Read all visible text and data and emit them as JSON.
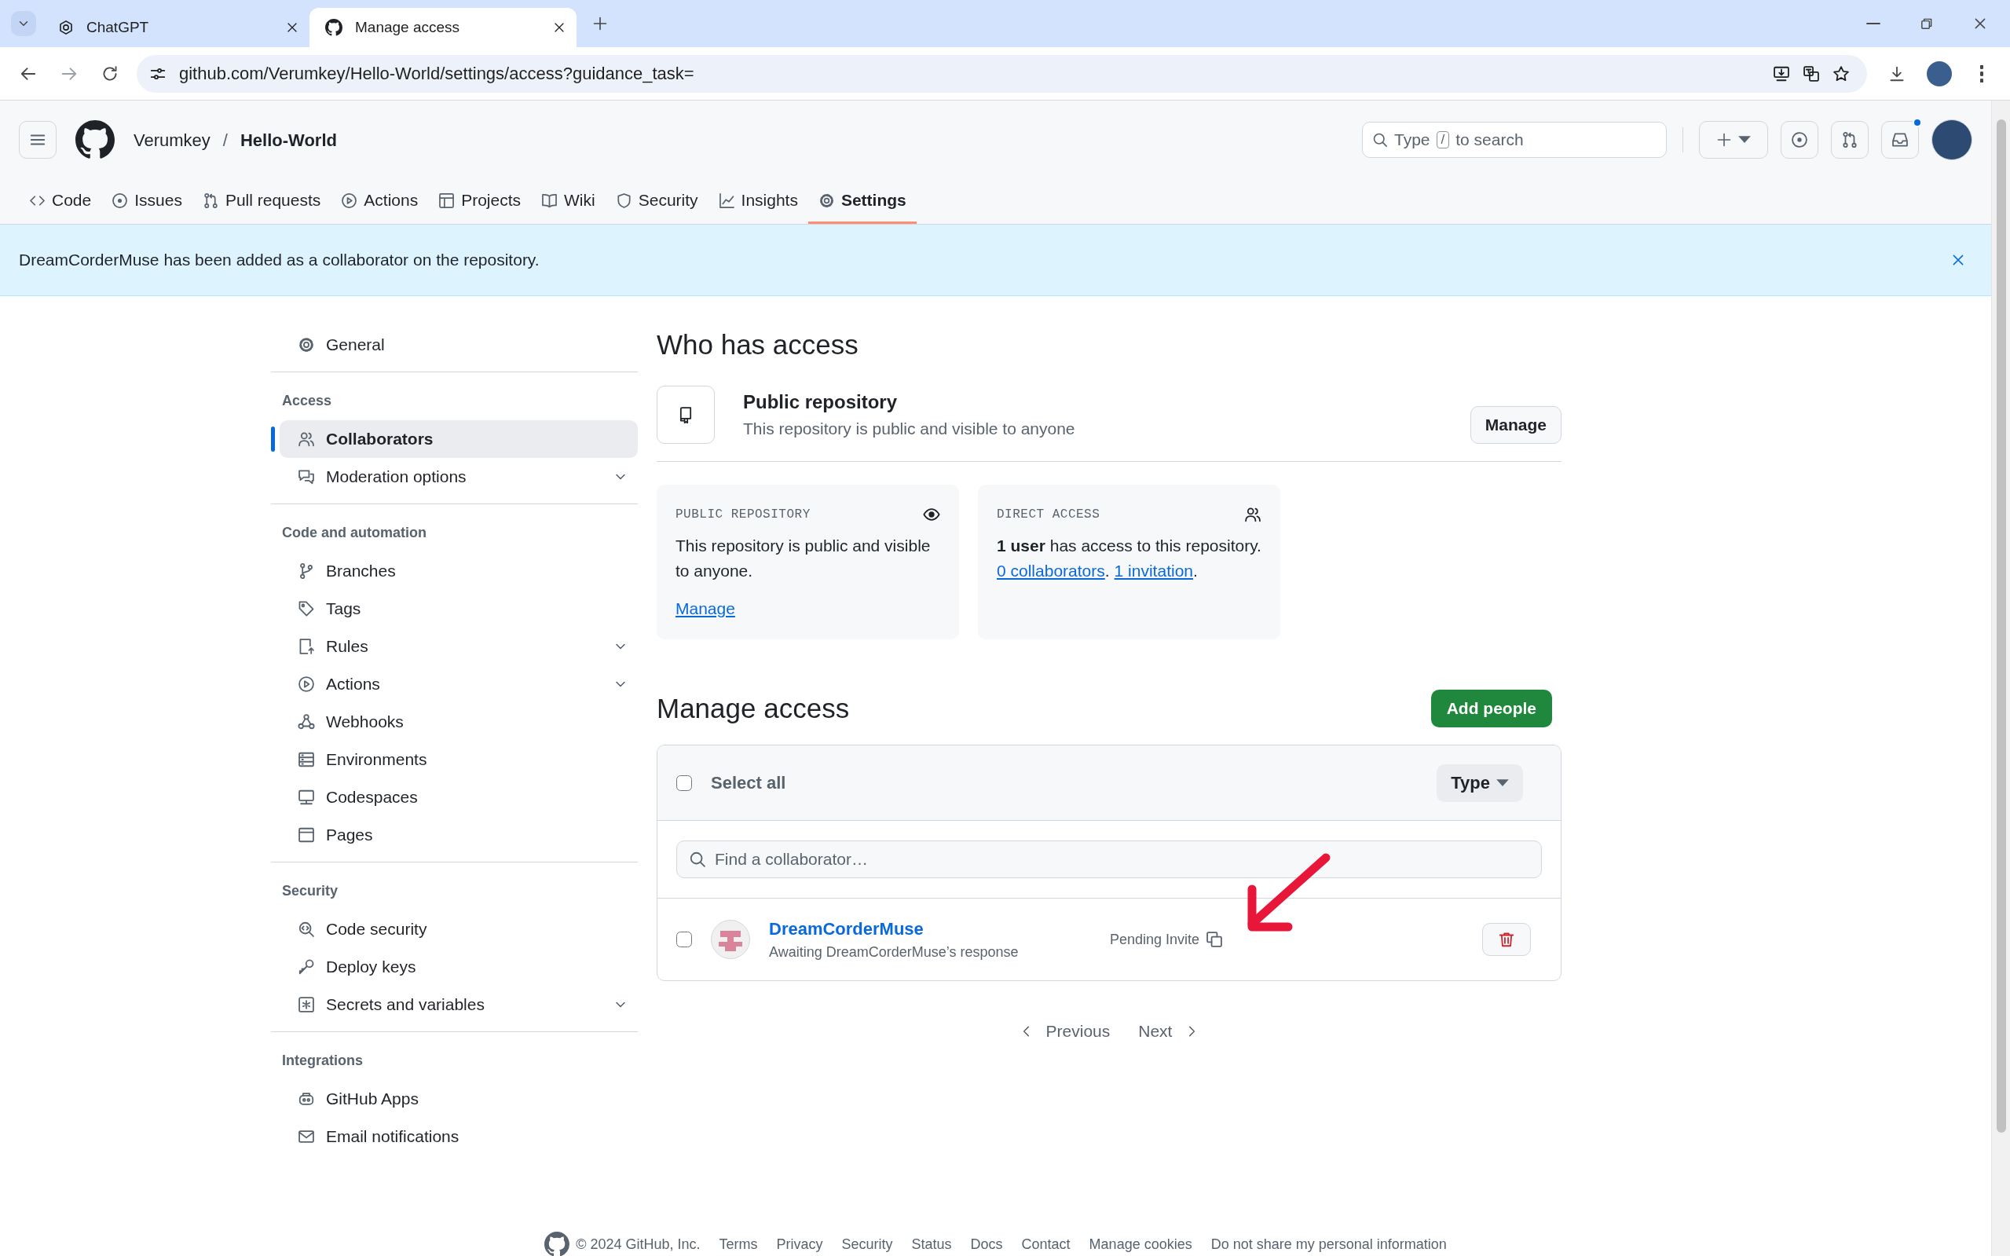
{
  "browser": {
    "tabs": [
      {
        "title": "ChatGPT",
        "selected": false
      },
      {
        "title": "Manage access",
        "selected": true
      }
    ],
    "url": "github.com/Verumkey/Hello-World/settings/access?guidance_task="
  },
  "header": {
    "owner": "Verumkey",
    "separator": "/",
    "repo": "Hello-World",
    "search": {
      "before": "Type",
      "key": "/",
      "after": "to search"
    },
    "notification_dot": true
  },
  "repo_tabs": [
    {
      "label": "Code",
      "selected": false
    },
    {
      "label": "Issues",
      "selected": false
    },
    {
      "label": "Pull requests",
      "selected": false
    },
    {
      "label": "Actions",
      "selected": false
    },
    {
      "label": "Projects",
      "selected": false
    },
    {
      "label": "Wiki",
      "selected": false
    },
    {
      "label": "Security",
      "selected": false
    },
    {
      "label": "Insights",
      "selected": false
    },
    {
      "label": "Settings",
      "selected": true
    }
  ],
  "banner": {
    "text": "DreamCorderMuse has been added as a collaborator on the repository."
  },
  "sidebar": {
    "groups": [
      {
        "items": [
          {
            "label": "General",
            "selected": false,
            "expandable": false
          }
        ]
      },
      {
        "heading": "Access",
        "items": [
          {
            "label": "Collaborators",
            "selected": true,
            "expandable": false
          },
          {
            "label": "Moderation options",
            "selected": false,
            "expandable": true
          }
        ]
      },
      {
        "heading": "Code and automation",
        "items": [
          {
            "label": "Branches",
            "selected": false,
            "expandable": false
          },
          {
            "label": "Tags",
            "selected": false,
            "expandable": false
          },
          {
            "label": "Rules",
            "selected": false,
            "expandable": true
          },
          {
            "label": "Actions",
            "selected": false,
            "expandable": true
          },
          {
            "label": "Webhooks",
            "selected": false,
            "expandable": false
          },
          {
            "label": "Environments",
            "selected": false,
            "expandable": false
          },
          {
            "label": "Codespaces",
            "selected": false,
            "expandable": false
          },
          {
            "label": "Pages",
            "selected": false,
            "expandable": false
          }
        ]
      },
      {
        "heading": "Security",
        "items": [
          {
            "label": "Code security",
            "selected": false,
            "expandable": false
          },
          {
            "label": "Deploy keys",
            "selected": false,
            "expandable": false
          },
          {
            "label": "Secrets and variables",
            "selected": false,
            "expandable": true
          }
        ]
      },
      {
        "heading": "Integrations",
        "items": [
          {
            "label": "GitHub Apps",
            "selected": false,
            "expandable": false
          },
          {
            "label": "Email notifications",
            "selected": false,
            "expandable": false
          }
        ]
      }
    ]
  },
  "who_has_access": {
    "title": "Who has access",
    "visibility": {
      "title": "Public repository",
      "description": "This repository is public and visible to anyone",
      "button": "Manage"
    },
    "cards": [
      {
        "heading": "PUBLIC REPOSITORY",
        "text": "This repository is public and visible to anyone.",
        "links": [
          {
            "kind": "link",
            "text": "Manage"
          }
        ]
      },
      {
        "heading": "DIRECT ACCESS",
        "text": "**1 user** has access to this repository.",
        "links": [
          {
            "kind": "link",
            "text": "0 collaborators"
          },
          {
            "kind": "text",
            "text": "."
          },
          {
            "kind": "link",
            "text": "1 invitation"
          },
          {
            "kind": "text",
            "text": "."
          }
        ]
      }
    ]
  },
  "manage_access": {
    "title": "Manage access",
    "add_button": "Add people",
    "select_all": {
      "label": "Select all",
      "checked": false
    },
    "type_filter": "Type",
    "search": {
      "placeholder": "Find a collaborator…"
    },
    "collaborators": [
      {
        "name": "DreamCorderMuse",
        "status": "Awaiting DreamCorderMuse’s response",
        "badge": "Pending Invite",
        "checked": false
      }
    ],
    "pagination": {
      "previous": "Previous",
      "next": "Next"
    }
  },
  "footer": {
    "copyright": "© 2024 GitHub, Inc.",
    "links": [
      "Terms",
      "Privacy",
      "Security",
      "Status",
      "Docs",
      "Contact",
      "Manage cookies",
      "Do not share my personal information"
    ]
  }
}
